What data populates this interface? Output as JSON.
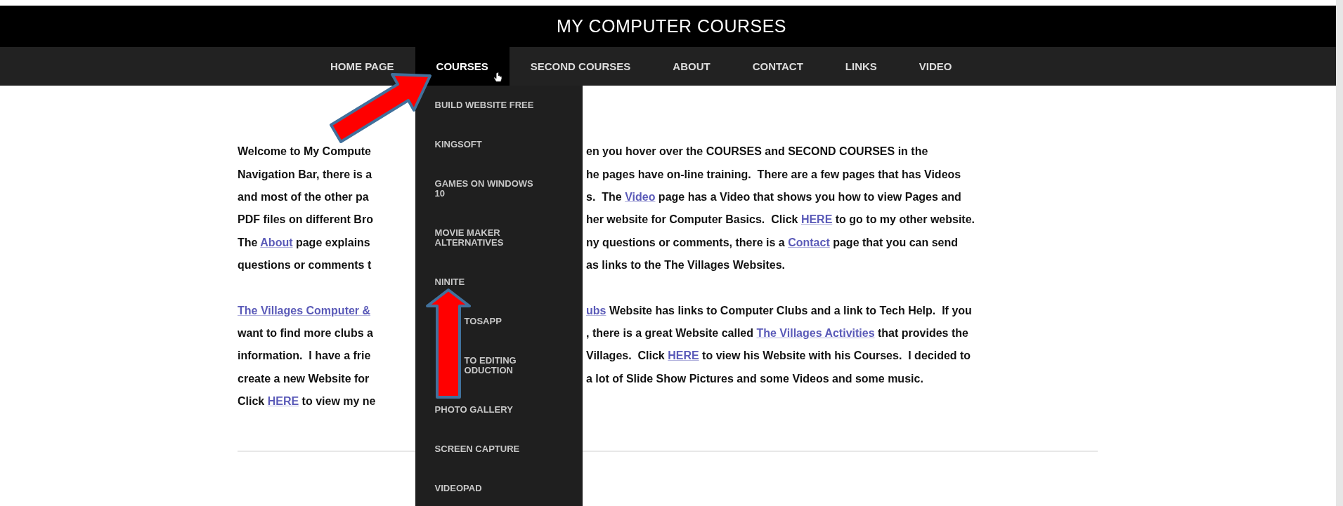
{
  "site_title": "MY COMPUTER COURSES",
  "nav": [
    {
      "label": "HOME PAGE",
      "selected": false
    },
    {
      "label": "COURSES",
      "selected": true,
      "dropdown": [
        {
          "label": "BUILD WEBSITE FREE",
          "kind": "item"
        },
        {
          "label": "KINGSOFT",
          "kind": "item"
        },
        {
          "label": "GAMES ON WINDOWS 10",
          "kind": "item"
        },
        {
          "label": "MOVIE MAKER ALTERNATIVES",
          "kind": "item"
        },
        {
          "label": "NINITE",
          "kind": "item"
        },
        {
          "label": "TOSAPP",
          "kind": "covered"
        },
        {
          "label": "TO EDITING\nODUCTION",
          "kind": "covered"
        },
        {
          "label": "PHOTO GALLERY",
          "kind": "item"
        },
        {
          "label": "SCREEN CAPTURE",
          "kind": "item"
        },
        {
          "label": "VIDEOPAD",
          "kind": "item"
        }
      ]
    },
    {
      "label": "SECOND COURSES",
      "selected": false
    },
    {
      "label": "ABOUT",
      "selected": false
    },
    {
      "label": "CONTACT",
      "selected": false
    },
    {
      "label": "LINKS",
      "selected": false
    },
    {
      "label": "VIDEO",
      "selected": false
    }
  ],
  "paragraphs": [
    [
      {
        "left": [
          {
            "text": "Welcome to My Compute",
            "kind": "text"
          }
        ],
        "right": [
          {
            "text": "en you hover over the COURSES and SECOND COURSES in the",
            "kind": "text"
          }
        ]
      },
      {
        "left": [
          {
            "text": "Navigation Bar, there is a",
            "kind": "text"
          }
        ],
        "right": [
          {
            "text": "he pages have on-line training.  There are a few pages that has Videos",
            "kind": "text"
          }
        ]
      },
      {
        "left": [
          {
            "text": "and most of the other pa",
            "kind": "text"
          }
        ],
        "right": [
          {
            "text": "s.  The ",
            "kind": "text"
          },
          {
            "text": "Video",
            "kind": "link"
          },
          {
            "text": " page has a Video that shows you how to view Pages and",
            "kind": "text"
          }
        ]
      },
      {
        "left": [
          {
            "text": "PDF files on different Bro",
            "kind": "text"
          }
        ],
        "right": [
          {
            "text": "her website for Computer Basics.  Click ",
            "kind": "text"
          },
          {
            "text": "HERE",
            "kind": "link"
          },
          {
            "text": " to go to my other website.",
            "kind": "text"
          }
        ]
      },
      {
        "left": [
          {
            "text": "The ",
            "kind": "text"
          },
          {
            "text": "About",
            "kind": "link"
          },
          {
            "text": " page explains",
            "kind": "text"
          }
        ],
        "right": [
          {
            "text": "ny questions or comments, there is a ",
            "kind": "text"
          },
          {
            "text": "Contact",
            "kind": "link"
          },
          {
            "text": " page that you can send",
            "kind": "text"
          }
        ]
      },
      {
        "left": [
          {
            "text": "questions or comments t",
            "kind": "text"
          }
        ],
        "right": [
          {
            "text": "as links to the The Villages Websites.",
            "kind": "text"
          }
        ]
      }
    ],
    [
      {
        "left": [
          {
            "text": "The Villages Computer &",
            "kind": "link"
          }
        ],
        "right": [
          {
            "text": "ubs",
            "kind": "link"
          },
          {
            "text": " Website has links to Computer Clubs and a link to Tech Help.  If you",
            "kind": "text"
          }
        ]
      },
      {
        "left": [
          {
            "text": "want to find more clubs a",
            "kind": "text"
          }
        ],
        "right": [
          {
            "text": ", there is a great Website called ",
            "kind": "text"
          },
          {
            "text": "The Villages Activities",
            "kind": "link"
          },
          {
            "text": " that provides the",
            "kind": "text"
          }
        ]
      },
      {
        "left": [
          {
            "text": "information.  I have a frie",
            "kind": "text"
          }
        ],
        "right": [
          {
            "text": "Villages.  Click ",
            "kind": "text"
          },
          {
            "text": "HERE",
            "kind": "link"
          },
          {
            "text": " to view his Website with his Courses.  I decided to",
            "kind": "text"
          }
        ]
      },
      {
        "left": [
          {
            "text": "create a new Website for",
            "kind": "text"
          }
        ],
        "right": [
          {
            "text": "a lot of Slide Show Pictures and some Videos and some music.",
            "kind": "text"
          }
        ]
      },
      {
        "left": [
          {
            "text": "Click ",
            "kind": "text"
          },
          {
            "text": "HERE",
            "kind": "link"
          },
          {
            "text": " to view my ne",
            "kind": "text"
          }
        ]
      }
    ]
  ]
}
